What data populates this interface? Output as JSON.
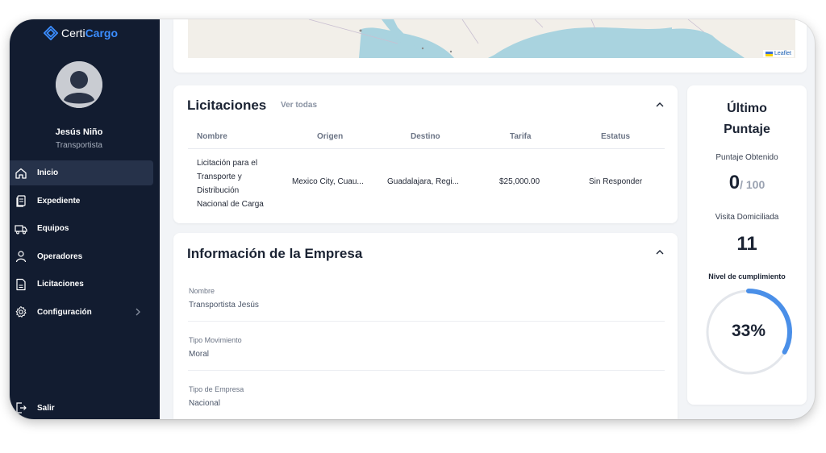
{
  "brand": {
    "logo_word1": "Certi",
    "logo_word2": "Cargo",
    "accent": "#3b8dff"
  },
  "user": {
    "name": "Jesús Niño",
    "role": "Transportista",
    "avatar_icon": "user-avatar-icon"
  },
  "sidebar": {
    "items": [
      {
        "label": "Inicio",
        "icon": "home-icon",
        "active": true
      },
      {
        "label": "Expediente",
        "icon": "folder-document-icon"
      },
      {
        "label": "Equipos",
        "icon": "truck-icon"
      },
      {
        "label": "Operadores",
        "icon": "person-icon"
      },
      {
        "label": "Licitaciones",
        "icon": "document-icon"
      },
      {
        "label": "Configuración",
        "icon": "gear-icon",
        "has_submenu": true
      }
    ],
    "logout_label": "Salir"
  },
  "map": {
    "attribution": "Leaflet"
  },
  "licitaciones": {
    "title": "Licitaciones",
    "view_all": "Ver todas",
    "columns": [
      "Nombre",
      "Origen",
      "Destino",
      "Tarifa",
      "Estatus"
    ],
    "rows": [
      {
        "nombre_lines": [
          "Licitación para el",
          "Transporte y",
          "Distribución",
          "Nacional de Carga"
        ],
        "origen": "Mexico City, Cuau...",
        "destino": "Guadalajara, Regi...",
        "tarifa": "$25,000.00",
        "estatus": "Sin Responder"
      }
    ]
  },
  "empresa": {
    "title": "Información de la Empresa",
    "fields": [
      {
        "label": "Nombre",
        "value": "Transportista Jesús"
      },
      {
        "label": "Tipo Movimiento",
        "value": "Moral"
      },
      {
        "label": "Tipo de Empresa",
        "value": "Nacional"
      }
    ]
  },
  "score": {
    "title_line1": "Último",
    "title_line2": "Puntaje",
    "obtained_label": "Puntaje Obtenido",
    "obtained_value": "0",
    "obtained_max": "/ 100",
    "visit_label": "Visita Domiciliada",
    "visit_value": "11",
    "compliance_label": "Nivel de cumplimiento",
    "compliance_text": "33%",
    "compliance_fraction": 0.33
  }
}
